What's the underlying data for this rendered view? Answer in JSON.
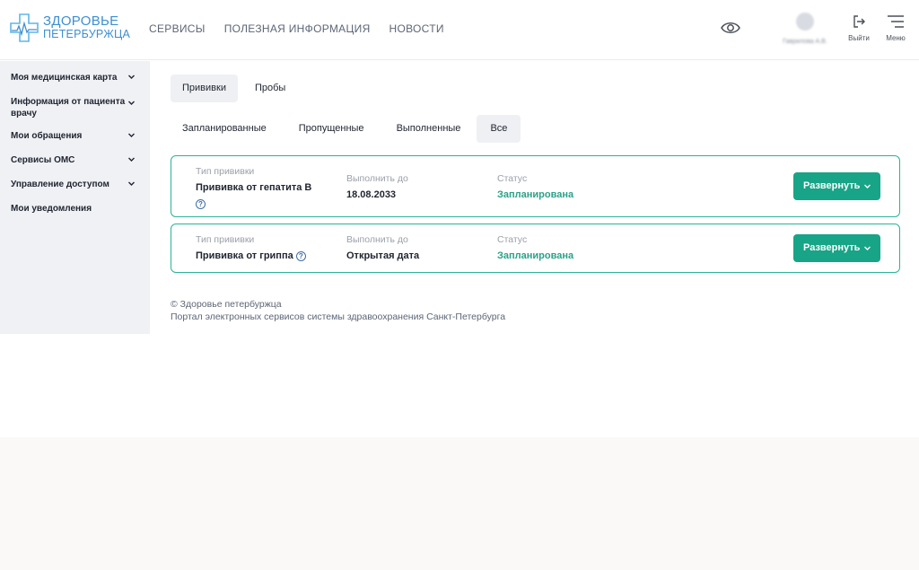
{
  "header": {
    "logo": {
      "line1": "ЗДОРОВЬЕ",
      "line2": "ПЕТЕРБУРЖЦА"
    },
    "nav": [
      {
        "label": "СЕРВИСЫ"
      },
      {
        "label": "ПОЛЕЗНАЯ ИНФОРМАЦИЯ"
      },
      {
        "label": "НОВОСТИ"
      }
    ],
    "user_name": "Гаврилова А.В.",
    "logout_label": "Выйти",
    "menu_label": "Меню",
    "icons": {
      "vision": "eye-icon",
      "logout": "logout-icon",
      "menu": "hamburger-icon"
    }
  },
  "sidebar": {
    "items": [
      {
        "label": "Моя медицинская карта",
        "has_chevron": true
      },
      {
        "label": "Информация от пациента врачу",
        "has_chevron": true
      },
      {
        "label": "Мои обращения",
        "has_chevron": true
      },
      {
        "label": "Сервисы ОМС",
        "has_chevron": true
      },
      {
        "label": "Управление доступом",
        "has_chevron": true
      },
      {
        "label": "Мои уведомления",
        "has_chevron": false
      }
    ]
  },
  "main": {
    "tabs": [
      {
        "label": "Прививки",
        "active": true
      },
      {
        "label": "Пробы",
        "active": false
      }
    ],
    "subtabs": [
      {
        "label": "Запланированные",
        "active": false
      },
      {
        "label": "Пропущенные",
        "active": false
      },
      {
        "label": "Выполненные",
        "active": false
      },
      {
        "label": "Все",
        "active": true
      }
    ],
    "columns": {
      "type": "Тип прививки",
      "due": "Выполнить до",
      "status": "Статус"
    },
    "cards": [
      {
        "type": "Прививка от гепатита В",
        "due": "18.08.2033",
        "status": "Запланирована",
        "button": "Развернуть"
      },
      {
        "type": "Прививка от гриппа",
        "due": "Открытая дата",
        "status": "Запланирована",
        "button": "Развернуть"
      }
    ],
    "help_glyph": "?"
  },
  "footer": {
    "line1": "© Здоровье петербуржца",
    "line2": "Портал электронных сервисов системы здравоохранения Санкт-Петербурга"
  },
  "colors": {
    "accent": "#17a487",
    "status": "#2aa189",
    "brand": "#3d8fd1",
    "card_border": "#2bb397"
  }
}
